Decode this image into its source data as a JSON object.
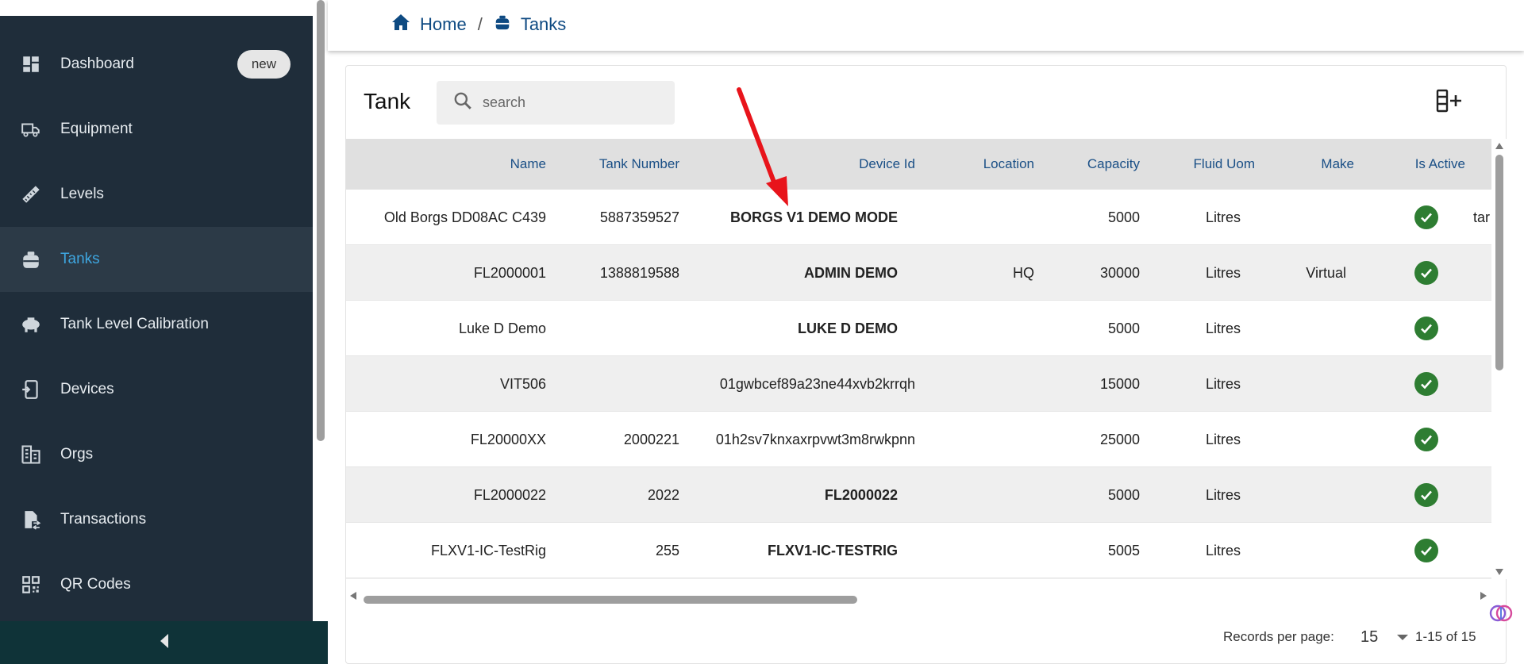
{
  "sidebar": {
    "items": [
      {
        "label": "Dashboard",
        "icon": "dashboard-icon",
        "badge": "new"
      },
      {
        "label": "Equipment",
        "icon": "truck-icon"
      },
      {
        "label": "Levels",
        "icon": "ruler-icon"
      },
      {
        "label": "Tanks",
        "icon": "tank-icon",
        "active": true
      },
      {
        "label": "Tank Level Calibration",
        "icon": "calibration-icon"
      },
      {
        "label": "Devices",
        "icon": "device-icon"
      },
      {
        "label": "Orgs",
        "icon": "building-icon"
      },
      {
        "label": "Transactions",
        "icon": "transaction-icon"
      },
      {
        "label": "QR Codes",
        "icon": "qr-icon"
      }
    ]
  },
  "breadcrumb": {
    "home": "Home",
    "separator": "/",
    "current": "Tanks"
  },
  "card": {
    "title": "Tank",
    "search_placeholder": "search"
  },
  "table": {
    "columns": [
      "Name",
      "Tank Number",
      "Device Id",
      "Location",
      "Capacity",
      "Fluid Uom",
      "Make",
      "Is Active"
    ],
    "rows": [
      {
        "name": "Old Borgs DD08AC C439",
        "tank_number": "5887359527",
        "device_id": "BORGS V1 DEMO MODE",
        "location": "",
        "capacity": "5000",
        "fluid_uom": "Litres",
        "make": "",
        "overflow": "tar"
      },
      {
        "name": "FL2000001",
        "tank_number": "1388819588",
        "device_id": "ADMIN DEMO",
        "location": "HQ",
        "capacity": "30000",
        "fluid_uom": "Litres",
        "make": "Virtual",
        "overflow": ""
      },
      {
        "name": "Luke D Demo",
        "tank_number": "",
        "device_id": "LUKE D DEMO",
        "location": "",
        "capacity": "5000",
        "fluid_uom": "Litres",
        "make": "",
        "overflow": ""
      },
      {
        "name": "VIT506",
        "tank_number": "",
        "device_id": "01gwbcef89a23ne44xvb2krrqh",
        "location": "",
        "capacity": "15000",
        "fluid_uom": "Litres",
        "make": "",
        "overflow": ""
      },
      {
        "name": "FL20000XX",
        "tank_number": "2000221",
        "device_id": "01h2sv7knxaxrpvwt3m8rwkpnn",
        "location": "",
        "capacity": "25000",
        "fluid_uom": "Litres",
        "make": "",
        "overflow": ""
      },
      {
        "name": "FL2000022",
        "tank_number": "2022",
        "device_id": "FL2000022",
        "location": "",
        "capacity": "5000",
        "fluid_uom": "Litres",
        "make": "",
        "overflow": ""
      },
      {
        "name": "FLXV1-IC-TestRig",
        "tank_number": "255",
        "device_id": "FLXV1-IC-TESTRIG",
        "location": "",
        "capacity": "5005",
        "fluid_uom": "Litres",
        "make": "",
        "overflow": ""
      }
    ]
  },
  "footer": {
    "records_per_page_label": "Records per page:",
    "records_per_page": "15",
    "range": "1-15 of 15"
  },
  "colors": {
    "sidebar_bg": "#1f2d3a",
    "accent": "#3ea6e0",
    "link": "#0e4a82",
    "active_check": "#2e7d32",
    "arrow": "#e8141b"
  }
}
